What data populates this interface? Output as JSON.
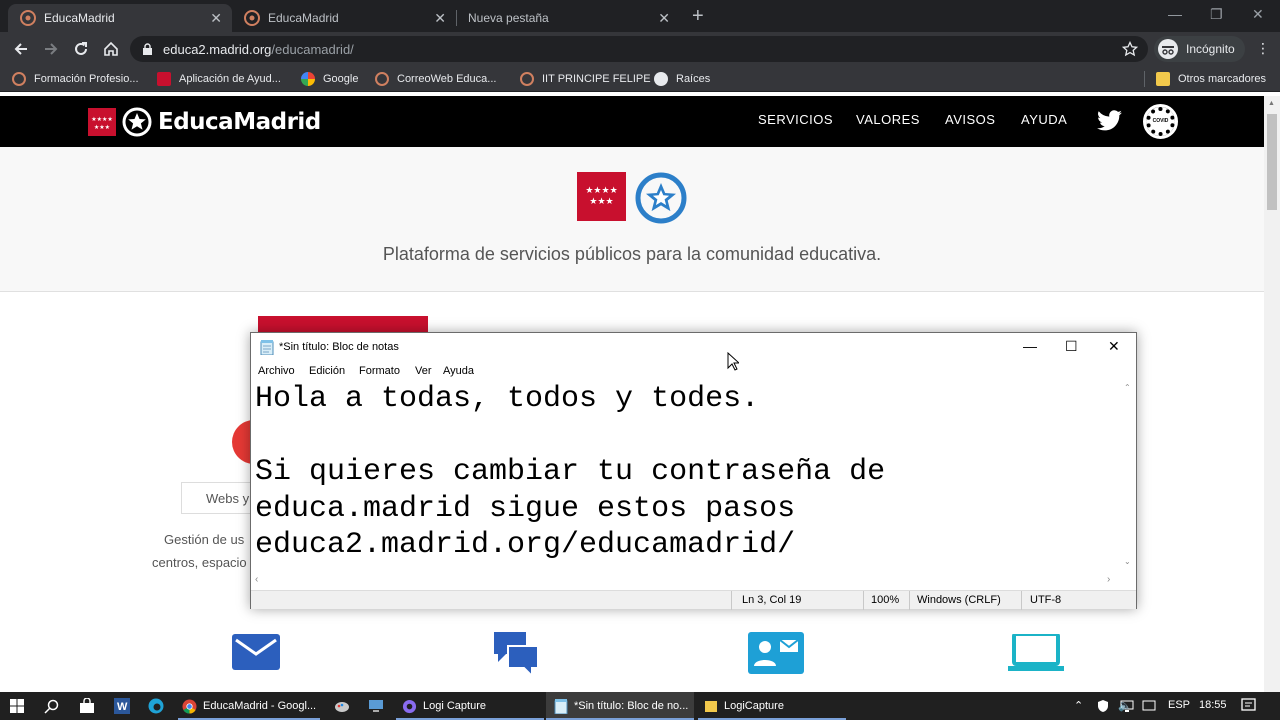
{
  "browser": {
    "tabs": [
      {
        "title": "EducaMadrid",
        "active": true
      },
      {
        "title": "EducaMadrid",
        "active": false
      },
      {
        "title": "Nueva pestaña",
        "active": false
      }
    ],
    "url_host": "educa2.madrid.org",
    "url_path": "/educamadrid/",
    "incognito_label": "Incógnito",
    "bookmarks": [
      "Formación Profesio...",
      "Aplicación de Ayud...",
      "Google",
      "CorreoWeb Educa...",
      "IIT PRINCIPE FELIPE",
      "Raíces"
    ],
    "other_bookmarks": "Otros marcadores"
  },
  "site": {
    "brand": "EducaMadrid",
    "nav": [
      "SERVICIOS",
      "VALORES",
      "AVISOS",
      "AYUDA"
    ],
    "covid_badge": "COVID",
    "tagline": "Plataforma de servicios públicos para la comunidad educativa.",
    "webs_button": "Webs y",
    "desc_line1": "Gestión de us",
    "desc_line2": "centros, espacio",
    "brand_color": "#c8102e",
    "icon_color": "#2c5fbd",
    "laptop_color": "#1bb3c7"
  },
  "notepad": {
    "title": "*Sin título: Bloc de notas",
    "menu": [
      "Archivo",
      "Edición",
      "Formato",
      "Ver",
      "Ayuda"
    ],
    "content": "Hola a todas, todos y todes.\n\nSi quieres cambiar tu contraseña de\neduca.madrid sigue estos pasos\neduca2.madrid.org/educamadrid/",
    "status": {
      "position": "Ln 3, Col 19",
      "zoom": "100%",
      "line_ending": "Windows (CRLF)",
      "encoding": "UTF-8"
    }
  },
  "taskbar": {
    "items": [
      {
        "label": "EducaMadrid - Googl...",
        "active": false
      },
      {
        "label": "Logi Capture",
        "active": false
      },
      {
        "label": "*Sin título: Bloc de no...",
        "active": true
      },
      {
        "label": "LogiCapture",
        "active": false
      }
    ],
    "language": "ESP",
    "time": "18:55"
  }
}
